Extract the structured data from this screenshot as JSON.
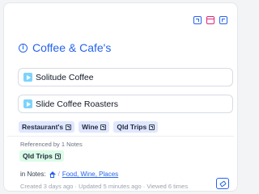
{
  "card": {
    "title": "Coffee & Cafe's",
    "links": [
      {
        "label": "Solitude Coffee"
      },
      {
        "label": "Slide Coffee Roasters"
      }
    ],
    "tags": [
      {
        "label": "Restaurant's"
      },
      {
        "label": "Wine"
      },
      {
        "label": "Qld Trips"
      }
    ],
    "references": {
      "label": "Referenced by 1 Notes",
      "tags": [
        {
          "label": "Qld Trips"
        }
      ]
    },
    "in_notes": {
      "prefix": "in Notes:",
      "separator": "/",
      "path": "Food, Wine, Places"
    },
    "meta": "Created 3 days ago · Updated 5 minutes ago · Viewed 6 times"
  },
  "icons": [
    "open-external-icon",
    "window-icon",
    "expand-icon",
    "info-icon",
    "play-icon",
    "home-icon",
    "eraser-icon"
  ],
  "colors": {
    "accent": "#2563eb",
    "tag_bg": "#e0e7ff",
    "ref_tag_bg": "#dcfce7"
  }
}
